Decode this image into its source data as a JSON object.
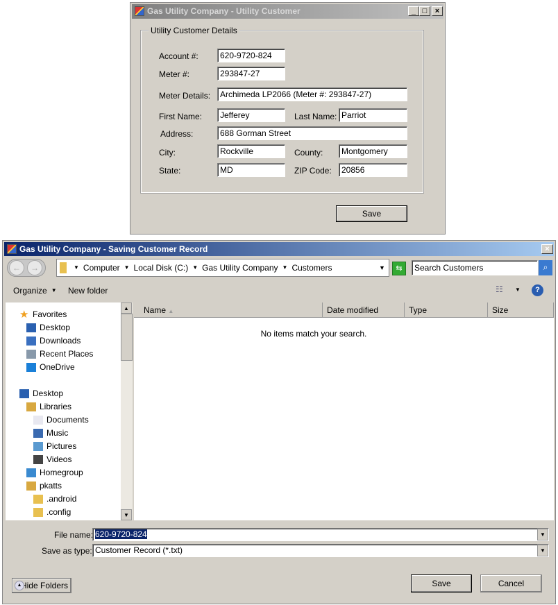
{
  "customer_window": {
    "title": "Gas Utility Company - Utility Customer",
    "group_title": "Utility Customer Details",
    "fields": {
      "account_label": "Account #:",
      "account": "620-9720-824",
      "meter_label": "Meter #:",
      "meter": "293847-27",
      "meter_details_label": "Meter Details:",
      "meter_details": "Archimeda LP2066 (Meter #: 293847-27)",
      "first_name_label": "First Name:",
      "first_name": "Jefferey",
      "last_name_label": "Last Name:",
      "last_name": "Parriot",
      "address_label": "Address:",
      "address": "688 Gorman Street",
      "city_label": "City:",
      "city": "Rockville",
      "county_label": "County:",
      "county": "Montgomery",
      "state_label": "State:",
      "state": "MD",
      "zip_label": "ZIP Code:",
      "zip": "20856"
    },
    "save_label": "Save",
    "controls": {
      "minimize": "_",
      "maximize": "□",
      "close": "×"
    }
  },
  "save_dialog": {
    "title": "Gas Utility Company - Saving Customer Record",
    "close": "×",
    "breadcrumb": [
      "Computer",
      "Local Disk (C:)",
      "Gas Utility Company",
      "Customers"
    ],
    "search_placeholder": "Search Customers",
    "toolbar": {
      "organize": "Organize",
      "new_folder": "New folder"
    },
    "nav_items": [
      {
        "label": "Favorites",
        "icon": "star-icon",
        "indent": 0
      },
      {
        "label": "Desktop",
        "icon": "desktop-icon",
        "indent": 1
      },
      {
        "label": "Downloads",
        "icon": "downloads-icon",
        "indent": 1
      },
      {
        "label": "Recent Places",
        "icon": "recent-places-icon",
        "indent": 1
      },
      {
        "label": "OneDrive",
        "icon": "onedrive-icon",
        "indent": 1
      },
      {
        "label": "Desktop",
        "icon": "desktop-icon",
        "indent": 0
      },
      {
        "label": "Libraries",
        "icon": "libraries-icon",
        "indent": 1
      },
      {
        "label": "Documents",
        "icon": "documents-icon",
        "indent": 2
      },
      {
        "label": "Music",
        "icon": "music-icon",
        "indent": 2
      },
      {
        "label": "Pictures",
        "icon": "pictures-icon",
        "indent": 2
      },
      {
        "label": "Videos",
        "icon": "videos-icon",
        "indent": 2
      },
      {
        "label": "Homegroup",
        "icon": "homegroup-icon",
        "indent": 1
      },
      {
        "label": "pkatts",
        "icon": "user-folder-icon",
        "indent": 1
      },
      {
        "label": ".android",
        "icon": "folder-icon",
        "indent": 2
      },
      {
        "label": ".config",
        "icon": "folder-icon",
        "indent": 2
      }
    ],
    "columns": [
      "Name",
      "Date modified",
      "Type",
      "Size"
    ],
    "empty_message": "No items match your search.",
    "file_name_label": "File name:",
    "file_name": "620-9720-824",
    "save_type_label": "Save as type:",
    "save_type": "Customer Record (*.txt)",
    "hide_folders": "Hide Folders",
    "save": "Save",
    "cancel": "Cancel"
  },
  "colors": {
    "title_active": "#0a246a",
    "title_inactive": "#808080",
    "selection": "#0a246a",
    "window_bg": "#d4d0c8"
  }
}
